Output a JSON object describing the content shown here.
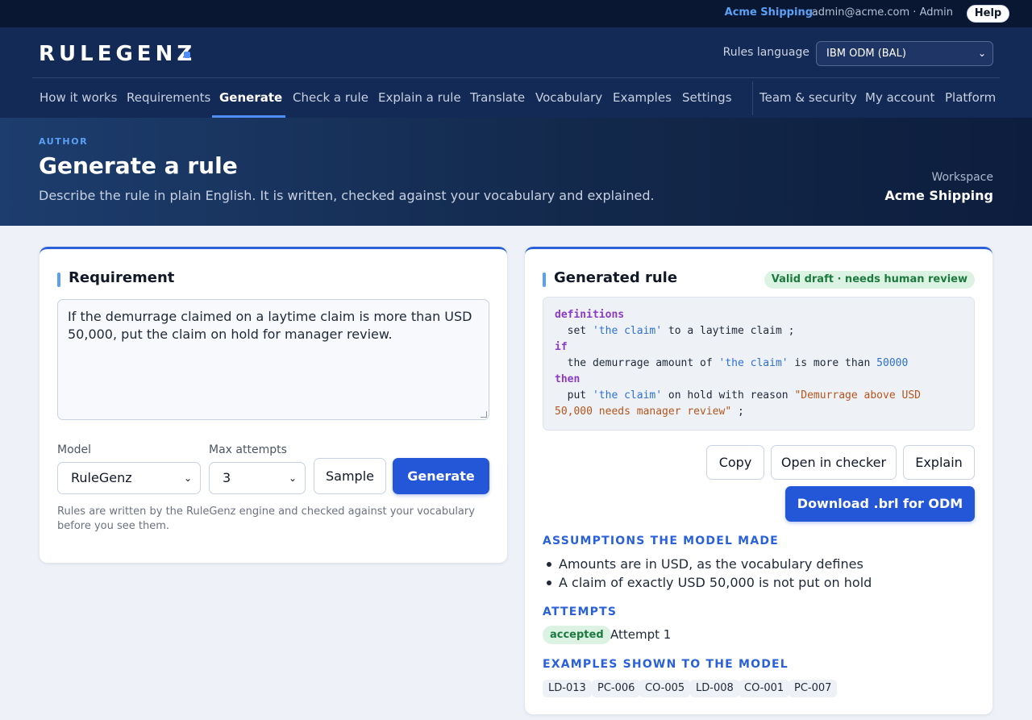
{
  "topbar": {
    "org": "Acme Shipping",
    "user": "admin@acme.com · Admin",
    "help_label": "Help"
  },
  "header": {
    "logo": "RULEGENZ",
    "rules_language_label": "Rules language",
    "rules_language_value": "IBM ODM (BAL)"
  },
  "nav": {
    "items": [
      "How it works",
      "Requirements",
      "Generate",
      "Check a rule",
      "Explain a rule",
      "Translate",
      "Vocabulary",
      "Examples",
      "Settings"
    ],
    "secondary": [
      "Team & security",
      "My account",
      "Platform"
    ],
    "active": "Generate"
  },
  "hero": {
    "eyebrow": "AUTHOR",
    "title": "Generate a rule",
    "subtitle": "Describe the rule in plain English. It is written, checked against your vocabulary and explained.",
    "workspace_label": "Workspace",
    "workspace_name": "Acme Shipping"
  },
  "requirement": {
    "title": "Requirement",
    "text": "If the demurrage claimed on a laytime claim is more than USD 50,000, put the claim on hold for manager review.",
    "model_label": "Model",
    "model_value": "RuleGenz",
    "attempts_label": "Max attempts",
    "attempts_value": "3",
    "sample_label": "Sample",
    "generate_label": "Generate",
    "note": "Rules are written by the RuleGenz engine and checked against your vocabulary before you see them."
  },
  "generated": {
    "title": "Generated rule",
    "status_badge": "Valid draft · needs human review",
    "code": {
      "l1_kw": "definitions",
      "l2_a": "  set ",
      "l2_str": "'the claim'",
      "l2_b": " to a laytime claim ;",
      "l3_kw": "if",
      "l4_a": "  the demurrage amount of ",
      "l4_str": "'the claim'",
      "l4_b": " is more than ",
      "l4_num": "50000",
      "l5_kw": "then",
      "l6_a": "  put ",
      "l6_str": "'the claim'",
      "l6_b": " on hold with reason ",
      "l6_lit": "\"Demurrage above USD",
      "l7_lit": "50,000 needs manager review\"",
      "l7_b": " ;"
    },
    "copy_label": "Copy",
    "open_checker_label": "Open in checker",
    "explain_label": "Explain",
    "download_label": "Download .brl for ODM",
    "assumptions_heading": "ASSUMPTIONS THE MODEL MADE",
    "assumptions": [
      "Amounts are in USD, as the vocabulary defines",
      "A claim of exactly USD 50,000 is not put on hold"
    ],
    "attempts_heading": "ATTEMPTS",
    "attempt_status": "accepted",
    "attempt_label": "Attempt 1",
    "examples_heading": "EXAMPLES SHOWN TO THE MODEL",
    "examples": [
      "LD-013",
      "PC-006",
      "CO-005",
      "LD-008",
      "CO-001",
      "PC-007"
    ]
  }
}
